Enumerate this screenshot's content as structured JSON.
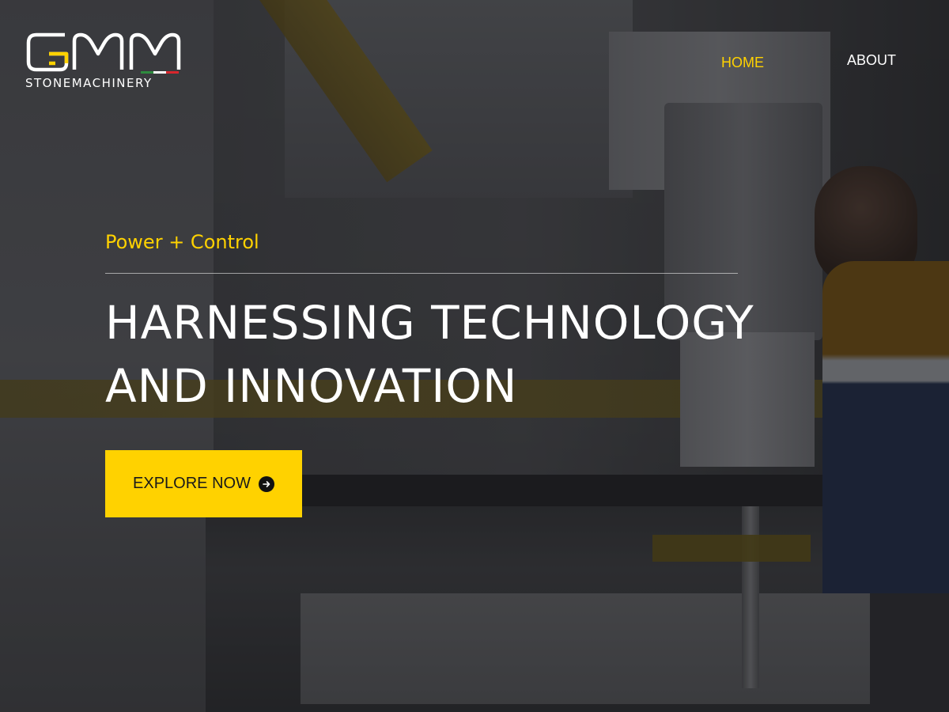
{
  "colors": {
    "accent": "#ffd200",
    "text": "#ffffff",
    "button_text": "#1a1a1a"
  },
  "header": {
    "logo": {
      "wordmark": "GMM",
      "subtitle": "STONEMACHINERY"
    },
    "nav": [
      {
        "label": "HOME",
        "active": true
      },
      {
        "label": "ABOUT",
        "active": false
      }
    ]
  },
  "hero": {
    "tagline": "Power + Control",
    "headline_lines": [
      "HARNESSING TECHNOLOGY",
      "AND INNOVATION"
    ],
    "cta": {
      "label": "EXPLORE NOW",
      "icon": "arrow-right-circle-icon"
    }
  }
}
